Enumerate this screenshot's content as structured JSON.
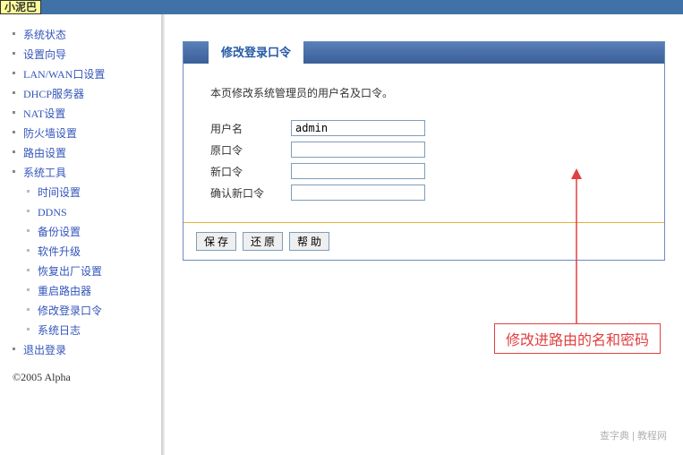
{
  "brand": "小泥巴",
  "sidebar": {
    "items": [
      {
        "label": "系统状态",
        "sub": false,
        "active": false
      },
      {
        "label": "设置向导",
        "sub": false,
        "active": false
      },
      {
        "label": "LAN/WAN口设置",
        "sub": false,
        "active": false
      },
      {
        "label": "DHCP服务器",
        "sub": false,
        "active": false
      },
      {
        "label": "NAT设置",
        "sub": false,
        "active": false
      },
      {
        "label": "防火墙设置",
        "sub": false,
        "active": false
      },
      {
        "label": "路由设置",
        "sub": false,
        "active": false
      },
      {
        "label": "系统工具",
        "sub": false,
        "active": false
      },
      {
        "label": "时间设置",
        "sub": true,
        "active": false
      },
      {
        "label": "DDNS",
        "sub": true,
        "active": false
      },
      {
        "label": "备份设置",
        "sub": true,
        "active": false
      },
      {
        "label": "软件升级",
        "sub": true,
        "active": false
      },
      {
        "label": "恢复出厂设置",
        "sub": true,
        "active": false
      },
      {
        "label": "重启路由器",
        "sub": true,
        "active": false
      },
      {
        "label": "修改登录口令",
        "sub": true,
        "active": true
      },
      {
        "label": "系统日志",
        "sub": true,
        "active": false
      },
      {
        "label": "退出登录",
        "sub": false,
        "active": false
      }
    ]
  },
  "copyright": "©2005 Alpha",
  "panel": {
    "title": "修改登录口令",
    "description": "本页修改系统管理员的用户名及口令。",
    "fields": {
      "username": {
        "label": "用户名",
        "value": "admin"
      },
      "old_password": {
        "label": "原口令",
        "value": ""
      },
      "new_password": {
        "label": "新口令",
        "value": ""
      },
      "confirm_password": {
        "label": "确认新口令",
        "value": ""
      }
    },
    "buttons": {
      "save": "保 存",
      "restore": "还 原",
      "help": "帮 助"
    }
  },
  "annotation": "修改进路由的名和密码",
  "watermark": "查字典 | 教程网"
}
